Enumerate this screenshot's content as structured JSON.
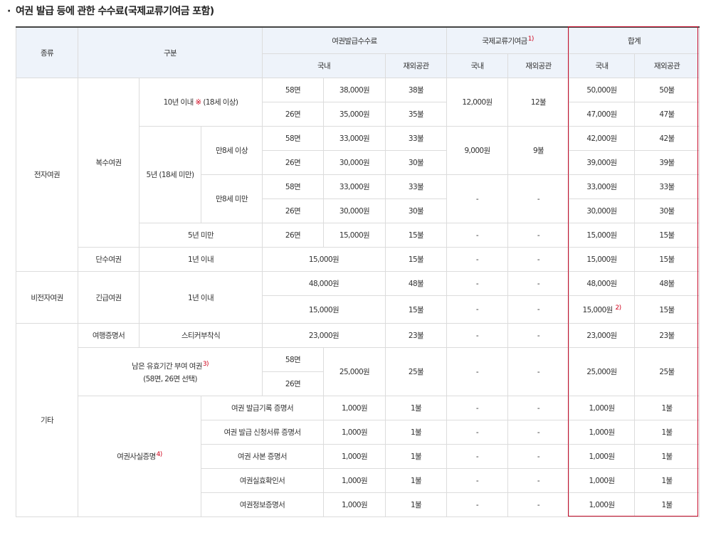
{
  "title": {
    "bullet": "·",
    "text": "여권 발급 등에 관한 수수료(국제교류기여금 포함)"
  },
  "colors": {
    "header_bg": "#eef3fa",
    "highlight_border": "#c8102e",
    "footnote_red": "#d0021b"
  },
  "header": {
    "type": "종류",
    "category": "구분",
    "issue_fee": "여권발급수수료",
    "intl_contrib": "국제교류기여금",
    "intl_contrib_note": "1)",
    "total": "합계",
    "domestic": "국내",
    "overseas": "재외공관"
  },
  "types": {
    "electronic": "전자여권",
    "non_electronic": "비전자여권",
    "other": "기타"
  },
  "sub": {
    "multiple": "복수여권",
    "single": "단수여권",
    "emergency": "긴급여권",
    "travel_cert": "여행증명서",
    "remaining_line1": "남은 유효기간 부여 여권",
    "remaining_note": "3)",
    "remaining_line2": "(58면, 26면 선택)",
    "fact_cert": "여권사실증명",
    "fact_cert_note": "4)"
  },
  "validity": {
    "ten_year_pre": "10년 이내",
    "ten_year_mark": "※",
    "ten_year_post": " (18세 이상)",
    "five_year": "5년 (18세 미만)",
    "age8_over": "만8세 이상",
    "age8_under": "만8세 미만",
    "under5": "5년 미만",
    "one_year": "1년 이내",
    "sticker": "스티커부착식"
  },
  "pages": {
    "p58": "58면",
    "p26": "26면"
  },
  "fees": {
    "f38000": "38,000원",
    "f35000": "35,000원",
    "f33000": "33,000원",
    "f30000": "30,000원",
    "f15000": "15,000원",
    "f48000": "48,000원",
    "f23000": "23,000원",
    "f25000": "25,000원",
    "f1000": "1,000원",
    "d38": "38불",
    "d35": "35불",
    "d33": "33불",
    "d30": "30불",
    "d15": "15불",
    "d48": "48불",
    "d23": "23불",
    "d25": "25불",
    "d1": "1불"
  },
  "intl": {
    "c12000": "12,000원",
    "c12d": "12불",
    "c9000": "9,000원",
    "c9d": "9불",
    "dash": "-"
  },
  "totals": {
    "t50000": "50,000원",
    "t50d": "50불",
    "t47000": "47,000원",
    "t47d": "47불",
    "t42000": "42,000원",
    "t42d": "42불",
    "t39000": "39,000원",
    "t39d": "39불",
    "t33000": "33,000원",
    "t33d": "33불",
    "t30000": "30,000원",
    "t30d": "30불",
    "t15000": "15,000원",
    "t15d": "15불",
    "t48000": "48,000원",
    "t48d": "48불",
    "t15000_note": "2)",
    "t23000": "23,000원",
    "t23d": "23불",
    "t25000": "25,000원",
    "t25d": "25불",
    "t1000": "1,000원",
    "t1d": "1불"
  },
  "fact_items": [
    "여권 발급기록 증명서",
    "여권 발급 신청서류 증명서",
    "여권 사본 증명서",
    "여권실효확인서",
    "여권정보증명서"
  ]
}
